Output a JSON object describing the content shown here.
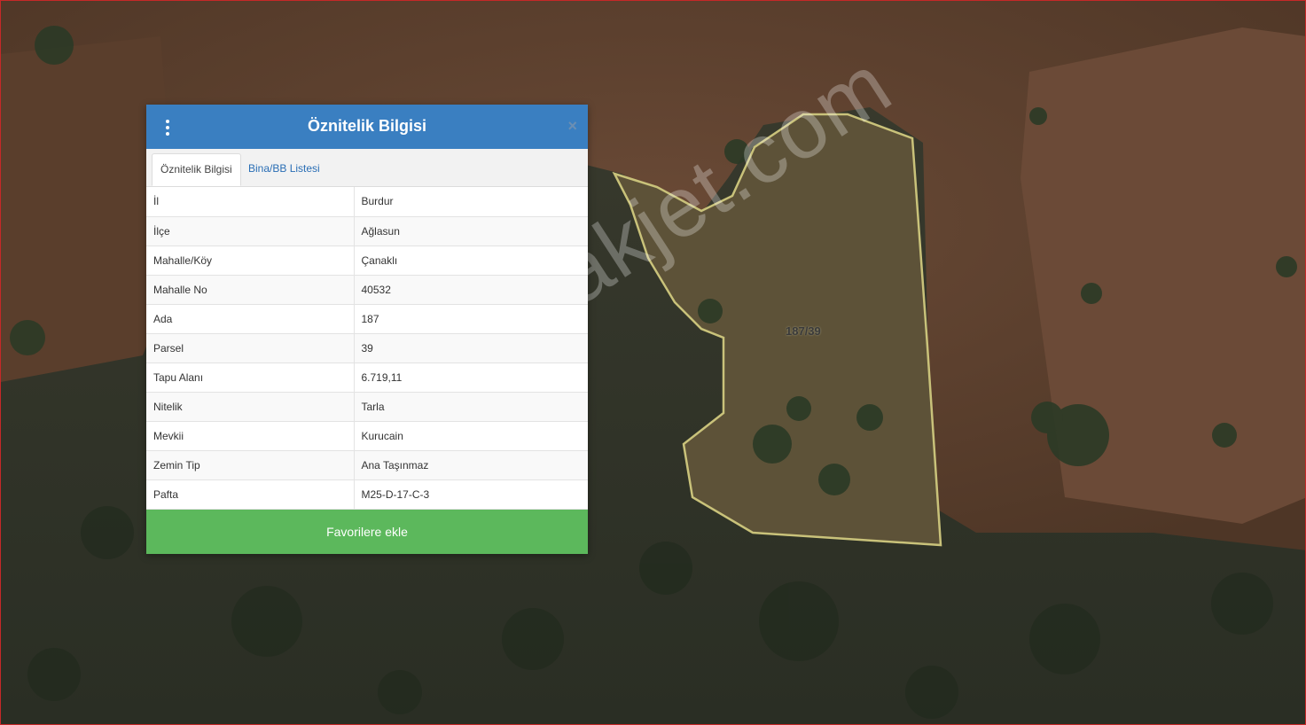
{
  "map": {
    "parcel_label": "187/39",
    "watermark": "emlakjet.com",
    "colors": {
      "parcel_outline": "#c9c27a"
    }
  },
  "panel": {
    "title": "Öznitelik Bilgisi",
    "menu_icon": "kebab-menu-icon",
    "close_icon": "close-icon",
    "close_label": "×",
    "tabs": [
      {
        "label": "Öznitelik Bilgisi",
        "active": true
      },
      {
        "label": "Bina/BB Listesi",
        "active": false
      }
    ],
    "rows": [
      {
        "key": "İl",
        "value": "Burdur"
      },
      {
        "key": "İlçe",
        "value": "Ağlasun"
      },
      {
        "key": "Mahalle/Köy",
        "value": "Çanaklı"
      },
      {
        "key": "Mahalle No",
        "value": "40532"
      },
      {
        "key": "Ada",
        "value": "187"
      },
      {
        "key": "Parsel",
        "value": "39"
      },
      {
        "key": "Tapu Alanı",
        "value": "6.719,11"
      },
      {
        "key": "Nitelik",
        "value": "Tarla"
      },
      {
        "key": "Mevkii",
        "value": "Kurucain"
      },
      {
        "key": "Zemin Tip",
        "value": "Ana Taşınmaz"
      },
      {
        "key": "Pafta",
        "value": "M25-D-17-C-3"
      }
    ],
    "favorite_button": "Favorilere ekle",
    "colors": {
      "header": "#3a7fc1",
      "button": "#5cb85c",
      "tab_link": "#2a6eb5"
    }
  }
}
